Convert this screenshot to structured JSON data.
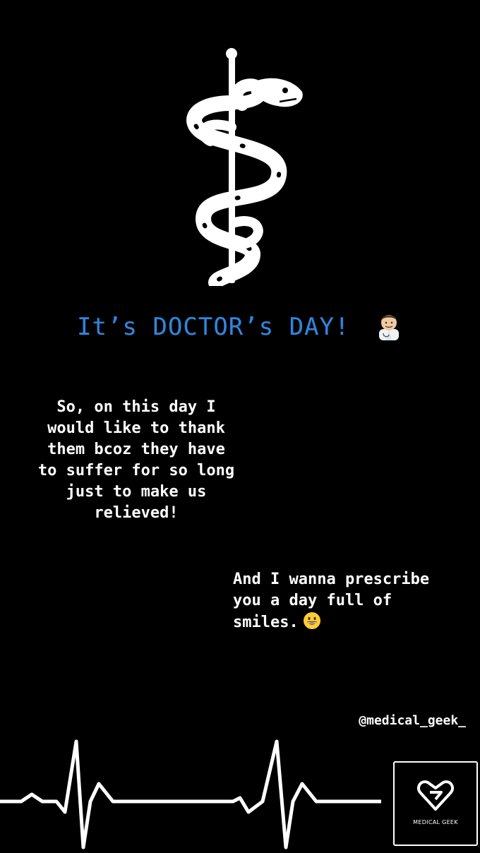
{
  "story": {
    "title": "It’s DOCTOR’s DAY!",
    "message_1": "So, on this day I\nwould like to thank\nthem bcoz they have\nto suffer for so long\njust to make us\nrelieved!",
    "message_2": "And I wanna prescribe\nyou a day full of\nsmiles.",
    "handle": "@medical_geek_",
    "logo_text": "MEDICAL GEEK"
  },
  "icons": {
    "symbol": "rod-of-asclepius-icon",
    "title_emoji": "man-health-worker-emoji",
    "smile_emoji": "grinning-face-emoji",
    "heartbeat": "ecg-heartbeat-line",
    "logo": "medical-geek-logo"
  },
  "colors": {
    "background": "#000000",
    "title": "#2f86e0",
    "text": "#ffffff"
  }
}
